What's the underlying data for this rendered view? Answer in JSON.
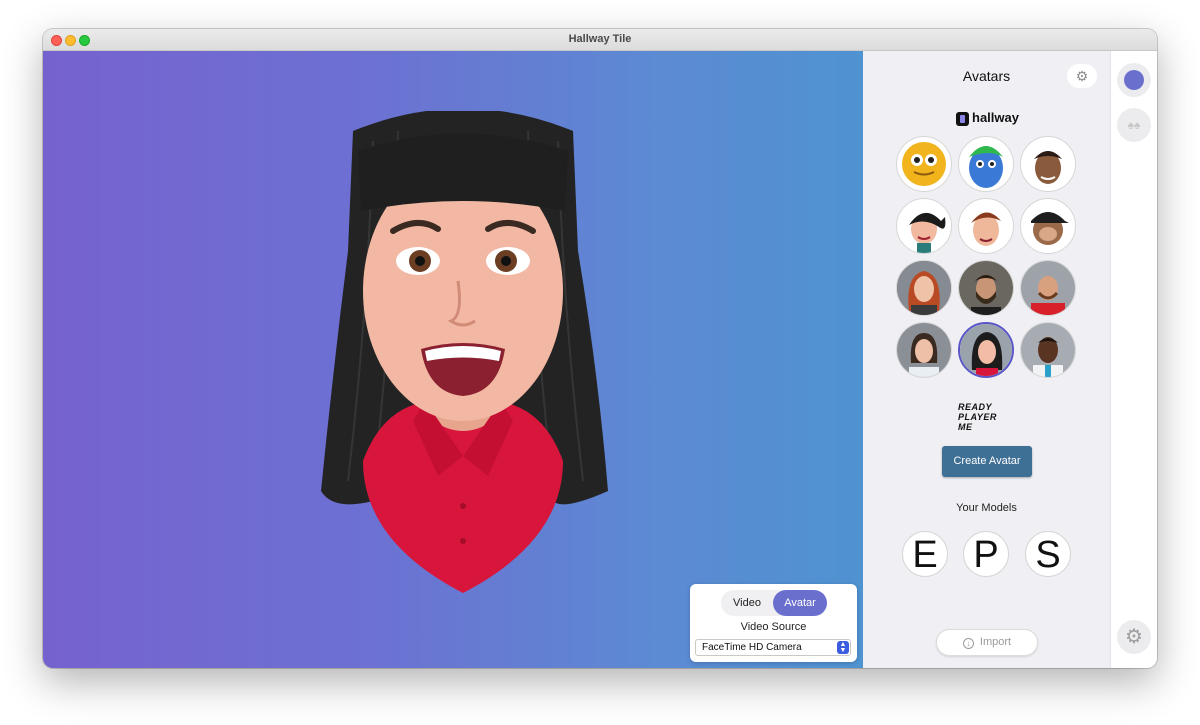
{
  "window": {
    "title": "Hallway Tile"
  },
  "stage": {
    "mode_toggle": {
      "video_label": "Video",
      "avatar_label": "Avatar",
      "selected": "Avatar"
    },
    "video_source_label": "Video Source",
    "video_source_value": "FaceTime HD Camera"
  },
  "panel": {
    "title": "Avatars",
    "brand": "hallway",
    "avatars": [
      {
        "name": "yellow-smiley-avatar"
      },
      {
        "name": "blue-green-hair-avatar"
      },
      {
        "name": "curly-hair-avatar"
      },
      {
        "name": "ponytail-girl-avatar"
      },
      {
        "name": "redhead-boy-avatar"
      },
      {
        "name": "cap-monkey-avatar"
      },
      {
        "name": "red-hair-woman-avatar"
      },
      {
        "name": "bearded-man-avatar"
      },
      {
        "name": "red-shirt-man-avatar"
      },
      {
        "name": "woman-white-shirt-avatar"
      },
      {
        "name": "black-hair-woman-avatar",
        "selected": true
      },
      {
        "name": "man-white-shirt-avatar"
      }
    ],
    "ready_player_me": [
      "READY",
      "PLAYER",
      "ME"
    ],
    "create_avatar_label": "Create Avatar",
    "your_models_title": "Your Models",
    "models": [
      "E",
      "P",
      "S"
    ],
    "import_label": "Import"
  },
  "colors": {
    "accent": "#6a6fce",
    "create_button": "#3e6f94"
  }
}
